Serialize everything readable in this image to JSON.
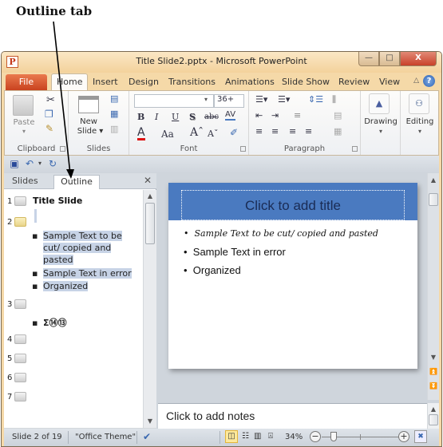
{
  "annotation": {
    "label": "Outline tab"
  },
  "window": {
    "app_icon": "P",
    "title": "Title Slide2.pptx  -  Microsoft PowerPoint",
    "buttons": {
      "minimize": "—",
      "restore": "□",
      "close": "X"
    }
  },
  "ribbon_tabs": {
    "file": "File",
    "tabs": [
      "Home",
      "Insert",
      "Design",
      "Transitions",
      "Animations",
      "Slide Show",
      "Review",
      "View"
    ],
    "active": "Home",
    "help": "?"
  },
  "ribbon": {
    "clipboard": {
      "label": "Clipboard",
      "paste": "Paste"
    },
    "slides": {
      "label": "Slides",
      "new_slide_line1": "New",
      "new_slide_line2": "Slide ▾"
    },
    "font": {
      "label": "Font",
      "font_name": "",
      "font_size": "36+",
      "bold": "B",
      "italic": "I",
      "underline": "U",
      "shadow": "S",
      "strike": "abc",
      "spacing": "AV",
      "font_color": "A",
      "change_case": "Aa",
      "grow": "Aˆ",
      "shrink": "Aˇ"
    },
    "paragraph": {
      "label": "Paragraph"
    },
    "drawing": {
      "label": "Drawing"
    },
    "editing": {
      "label": "Editing"
    }
  },
  "pane": {
    "tabs": [
      "Slides",
      "Outline"
    ],
    "active_tab": "Outline",
    "close": "✕",
    "slides": [
      {
        "num": "1",
        "title": "Title  Slide",
        "bullets": []
      },
      {
        "num": "2",
        "title": "",
        "selected": true,
        "bullets": [
          "Sample Text to be cut/ copied and pasted",
          "Sample Text in error",
          "Organized"
        ]
      },
      {
        "num": "3",
        "title": "",
        "bullets": [
          "Σ⑭⑬"
        ]
      },
      {
        "num": "4",
        "title": "",
        "bullets": []
      },
      {
        "num": "5",
        "title": "",
        "bullets": []
      },
      {
        "num": "6",
        "title": "",
        "bullets": []
      },
      {
        "num": "7",
        "title": "",
        "bullets": []
      }
    ]
  },
  "slide": {
    "title_placeholder": "Click to add title",
    "bullets": [
      "Sample Text to be cut/ copied and pasted",
      "Sample Text in error",
      "Organized"
    ],
    "banner_color": "#4a7ac0"
  },
  "notes": {
    "placeholder": "Click to add notes"
  },
  "status": {
    "slide_info": "Slide 2 of 19",
    "theme": "\"Office Theme\"",
    "zoom": "34%"
  }
}
